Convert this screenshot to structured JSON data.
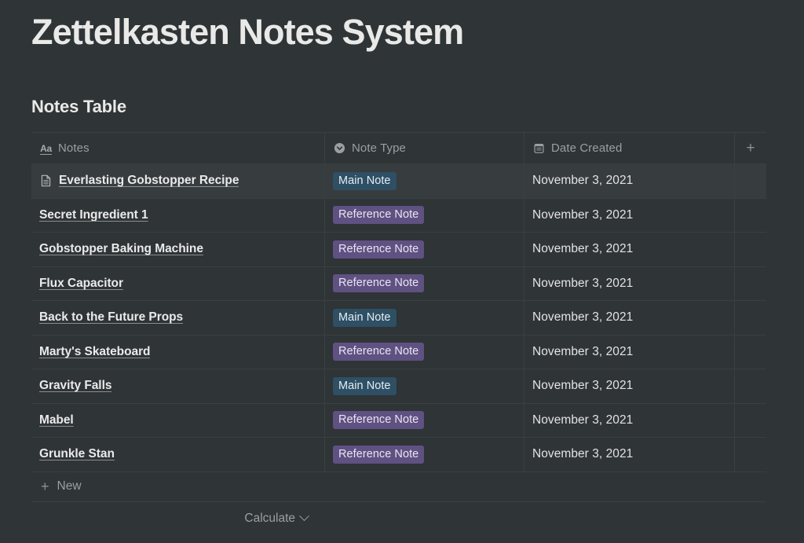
{
  "page": {
    "title": "Zettelkasten Notes System",
    "section_title": "Notes Table"
  },
  "table": {
    "columns": [
      {
        "label": "Notes",
        "icon": "title-aa-icon",
        "icon_glyph": "Aa"
      },
      {
        "label": "Note Type",
        "icon": "select-property-icon"
      },
      {
        "label": "Date Created",
        "icon": "calendar-icon"
      }
    ],
    "add_column_label": "+",
    "rows": [
      {
        "notes": "Everlasting Gobstopper Recipe",
        "note_type": "Main Note",
        "note_type_kind": "main",
        "date_created": "November 3, 2021",
        "has_page_icon": true,
        "hovered": true
      },
      {
        "notes": "Secret Ingredient 1",
        "note_type": "Reference Note",
        "note_type_kind": "reference",
        "date_created": "November 3, 2021",
        "has_page_icon": false,
        "hovered": false
      },
      {
        "notes": "Gobstopper Baking Machine",
        "note_type": "Reference Note",
        "note_type_kind": "reference",
        "date_created": "November 3, 2021",
        "has_page_icon": false,
        "hovered": false
      },
      {
        "notes": "Flux Capacitor",
        "note_type": "Reference Note",
        "note_type_kind": "reference",
        "date_created": "November 3, 2021",
        "has_page_icon": false,
        "hovered": false
      },
      {
        "notes": "Back to the Future Props",
        "note_type": "Main Note",
        "note_type_kind": "main",
        "date_created": "November 3, 2021",
        "has_page_icon": false,
        "hovered": false
      },
      {
        "notes": "Marty's Skateboard",
        "note_type": "Reference Note",
        "note_type_kind": "reference",
        "date_created": "November 3, 2021",
        "has_page_icon": false,
        "hovered": false
      },
      {
        "notes": "Gravity Falls",
        "note_type": "Main Note",
        "note_type_kind": "main",
        "date_created": "November 3, 2021",
        "has_page_icon": false,
        "hovered": false
      },
      {
        "notes": "Mabel",
        "note_type": "Reference Note",
        "note_type_kind": "reference",
        "date_created": "November 3, 2021",
        "has_page_icon": false,
        "hovered": false
      },
      {
        "notes": "Grunkle Stan",
        "note_type": "Reference Note",
        "note_type_kind": "reference",
        "date_created": "November 3, 2021",
        "has_page_icon": false,
        "hovered": false
      }
    ],
    "new_row_label": "New",
    "new_row_plus": "+",
    "calculate_label": "Calculate"
  },
  "colors": {
    "background": "#2f3437",
    "row_hover": "#373c3f",
    "border": "#3a3f42",
    "text_primary": "#e9e9e7",
    "text_secondary": "#9b9fa1",
    "badge_main_bg": "#2e4f64",
    "badge_reference_bg": "#5f5182"
  }
}
